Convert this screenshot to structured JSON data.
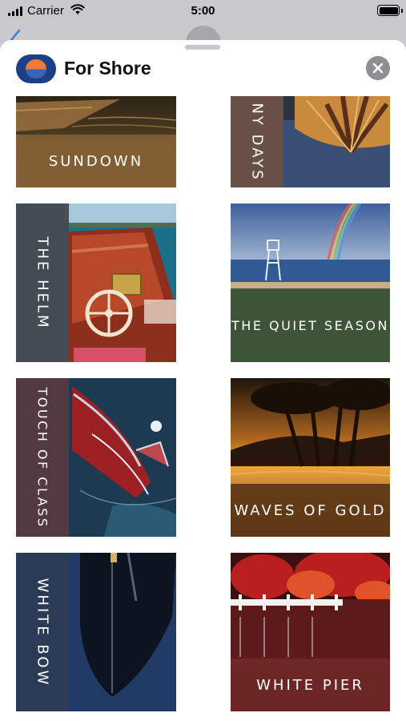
{
  "status_bar": {
    "carrier": "Carrier",
    "time": "5:00"
  },
  "app": {
    "title": "For Shore"
  },
  "tiles": [
    {
      "label": "SUNDOWN"
    },
    {
      "label": "NY DAYS"
    },
    {
      "label": "THE HELM"
    },
    {
      "label": "THE QUIET SEASON"
    },
    {
      "label": "TOUCH OF CLASS"
    },
    {
      "label": "WAVES OF GOLD"
    },
    {
      "label": "WHITE BOW"
    },
    {
      "label": "WHITE PIER"
    }
  ]
}
